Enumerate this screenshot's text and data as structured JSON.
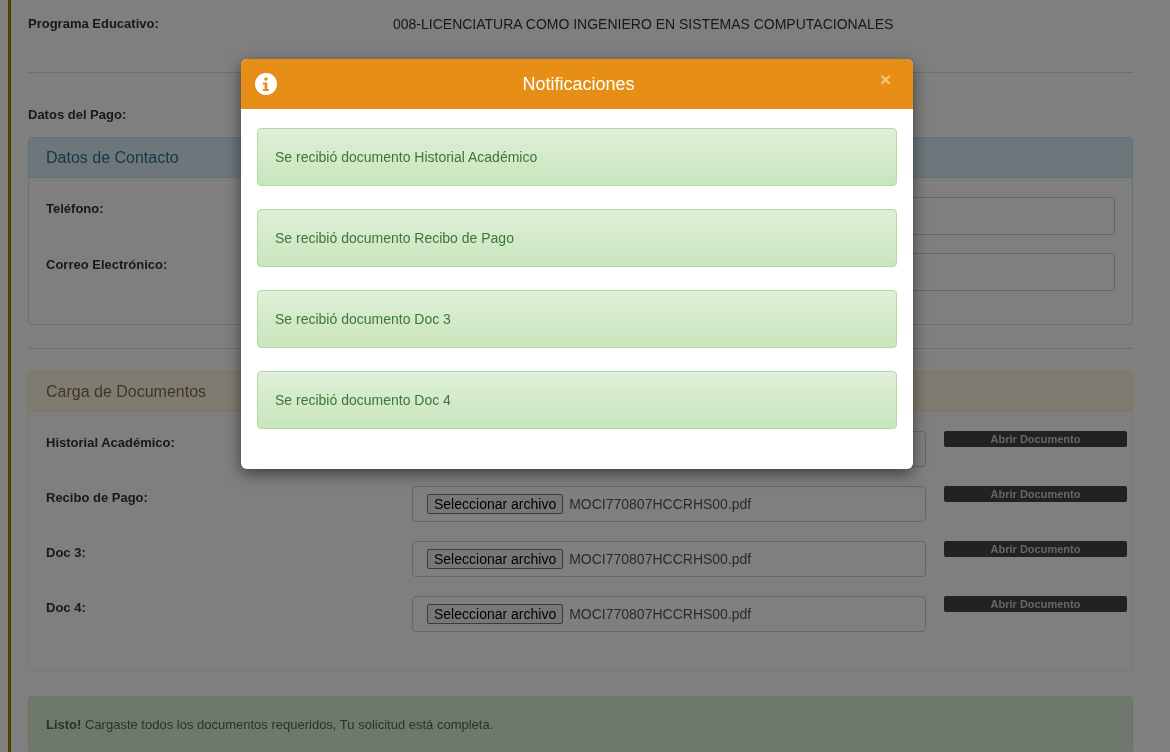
{
  "page": {
    "program": {
      "label": "Programa Educativo:",
      "value": "008-LICENCIATURA COMO INGENIERO EN SISTEMAS COMPUTACIONALES"
    },
    "payment_label": "Datos del Pago:",
    "contact_panel": {
      "title": "Datos de Contacto",
      "fields": [
        {
          "label": "Teléfono:"
        },
        {
          "label": "Correo Electrónico:"
        }
      ]
    },
    "documents_panel": {
      "title": "Carga de Documentos",
      "rows": [
        {
          "label": "Historial Académico:",
          "open_button": "Abrir Documento"
        },
        {
          "label": "Recibo de Pago:",
          "file_button": "Seleccionar archivo",
          "file_name": "MOCI770807HCCRHS00.pdf",
          "open_button": "Abrir Documento"
        },
        {
          "label": "Doc 3:",
          "file_button": "Seleccionar archivo",
          "file_name": "MOCI770807HCCRHS00.pdf",
          "open_button": "Abrir Documento"
        },
        {
          "label": "Doc 4:",
          "file_button": "Seleccionar archivo",
          "file_name": "MOCI770807HCCRHS00.pdf",
          "open_button": "Abrir Documento"
        }
      ]
    },
    "alert": "**Listo!** Cargaste todos los documentos requeridos, Tu solicitud está completa."
  },
  "modal": {
    "title": "Notificaciones",
    "close": "×",
    "messages": [
      "Se recibió documento Historial Académico",
      "Se recibió documento Recibo de Pago",
      "Se recibió documento Doc 3",
      "Se recibió documento Doc 4"
    ]
  }
}
